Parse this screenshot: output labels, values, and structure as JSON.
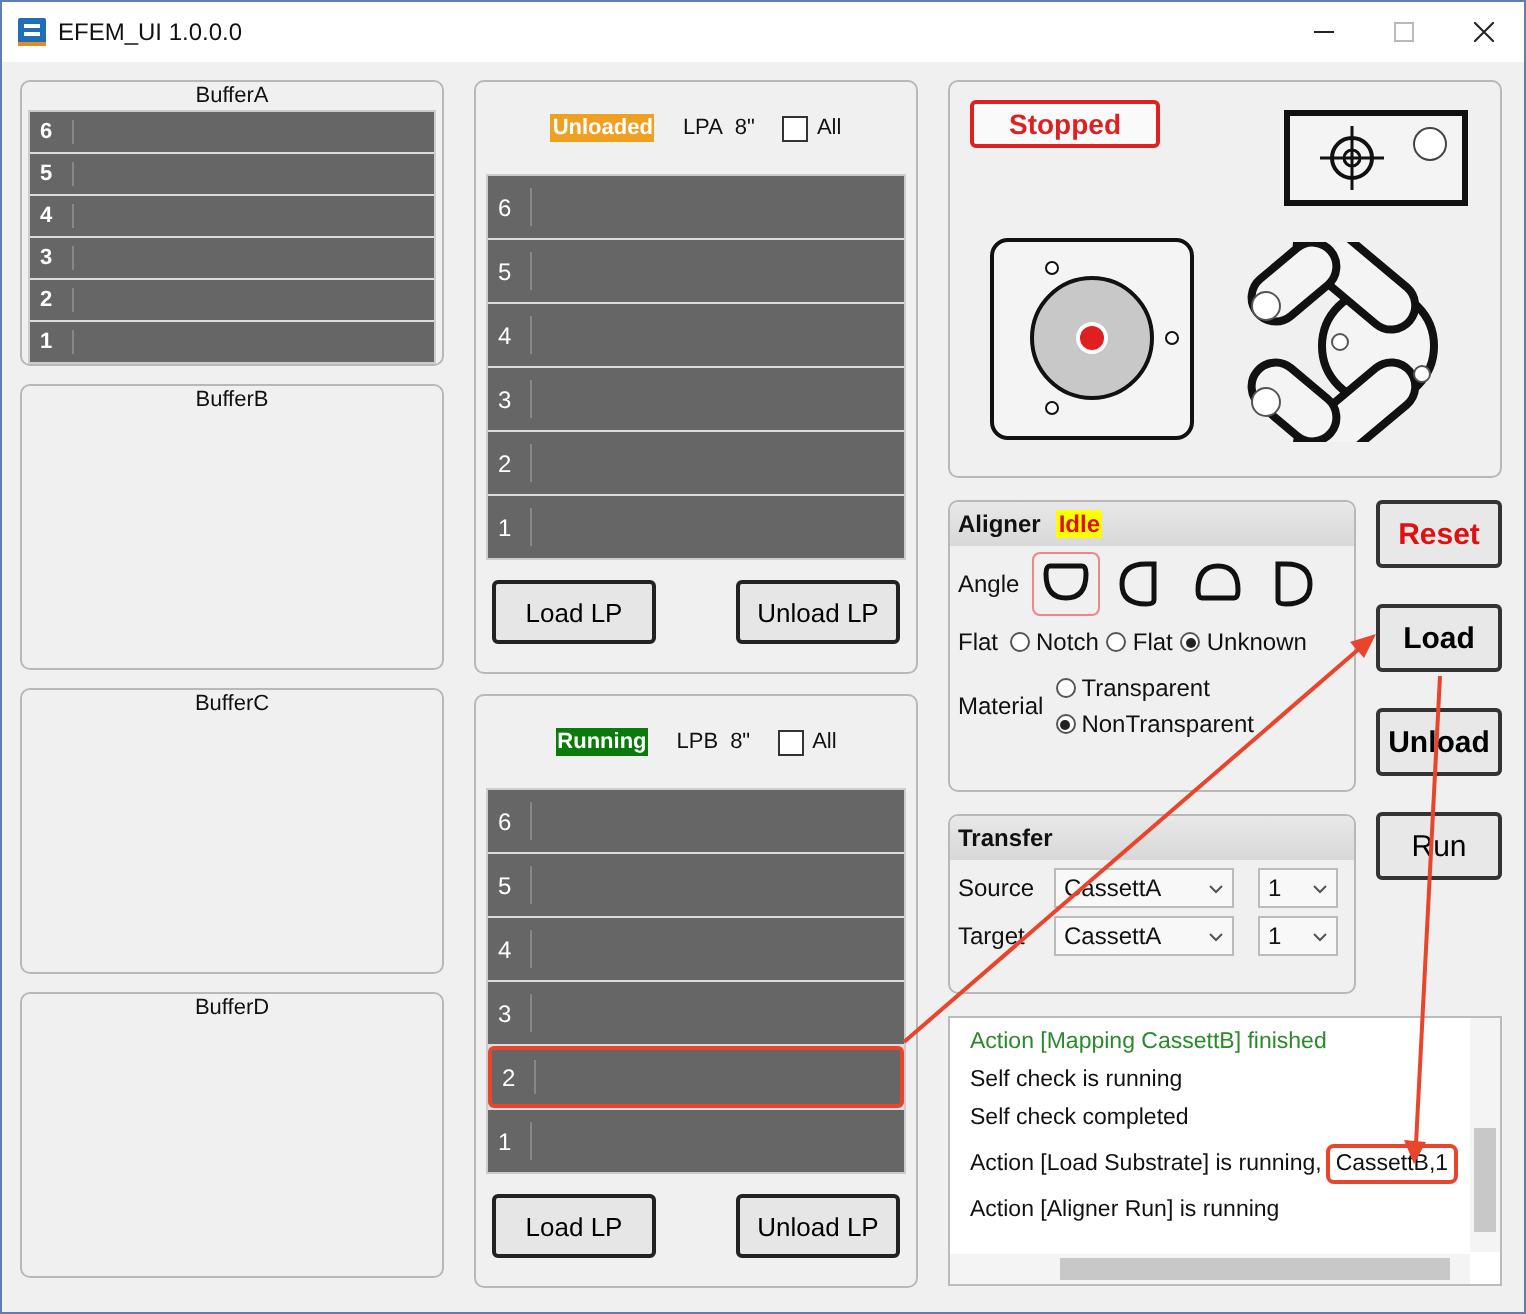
{
  "window": {
    "title": "EFEM_UI 1.0.0.0"
  },
  "buffers": [
    {
      "title": "BufferA",
      "slots": [
        "6",
        "5",
        "4",
        "3",
        "2",
        "1"
      ]
    },
    {
      "title": "BufferB"
    },
    {
      "title": "BufferC"
    },
    {
      "title": "BufferD"
    }
  ],
  "load_ports": [
    {
      "status": "Unloaded",
      "color": "#f0a020",
      "name": "LPA",
      "size": "8\"",
      "all_label": "All",
      "all_checked": false,
      "slots": [
        {
          "label": "6",
          "highlighted": false
        },
        {
          "label": "5",
          "highlighted": false
        },
        {
          "label": "4",
          "highlighted": false
        },
        {
          "label": "3",
          "highlighted": false
        },
        {
          "label": "2",
          "highlighted": false
        },
        {
          "label": "1",
          "highlighted": false
        }
      ],
      "buttons": [
        "Load LP",
        "Unload LP"
      ]
    },
    {
      "status": "Running",
      "color": "#0a7a0a",
      "name": "LPB",
      "size": "8\"",
      "all_label": "All",
      "all_checked": false,
      "slots": [
        {
          "label": "6",
          "highlighted": false
        },
        {
          "label": "5",
          "highlighted": false
        },
        {
          "label": "4",
          "highlighted": false
        },
        {
          "label": "3",
          "highlighted": false
        },
        {
          "label": "2",
          "highlighted": true
        },
        {
          "label": "1",
          "highlighted": false
        }
      ],
      "buttons": [
        "Load LP",
        "Unload LP"
      ]
    }
  ],
  "stage": {
    "status": "Stopped"
  },
  "aligner": {
    "title": "Aligner",
    "status": "Idle",
    "angle_label": "Angle",
    "angles": [
      {
        "kind": "top",
        "selected": true
      },
      {
        "kind": "right",
        "selected": false
      },
      {
        "kind": "bottom",
        "selected": false
      },
      {
        "kind": "left",
        "selected": false
      }
    ],
    "flat_label": "Flat",
    "flat_options": [
      {
        "label": "Notch",
        "selected": false
      },
      {
        "label": "Flat",
        "selected": false
      },
      {
        "label": "Unknown",
        "selected": true
      }
    ],
    "material_label": "Material",
    "material_options": [
      {
        "label": "Transparent",
        "selected": false
      },
      {
        "label": "NonTransparent",
        "selected": true
      }
    ]
  },
  "transfer": {
    "title": "Transfer",
    "rows": [
      {
        "label": "Source",
        "value": "CassettA",
        "slot": "1"
      },
      {
        "label": "Target",
        "value": "CassettA",
        "slot": "1"
      }
    ]
  },
  "side_buttons": [
    {
      "label": "Reset",
      "kind": "danger"
    },
    {
      "label": "Load",
      "kind": "bold"
    },
    {
      "label": "Unload",
      "kind": "bold"
    },
    {
      "label": "Run",
      "kind": "plain"
    }
  ],
  "log": [
    {
      "text": "Action [Mapping CassettB] finished",
      "kind": "success"
    },
    {
      "text": "Self check is running",
      "kind": "info"
    },
    {
      "text": "Self check completed",
      "kind": "info"
    },
    {
      "text": "Action [Load Substrate] is running,",
      "kind": "info",
      "detail": "CassettB,1",
      "highlighted": true
    },
    {
      "text": "Action [Aligner Run] is running",
      "kind": "info"
    }
  ]
}
